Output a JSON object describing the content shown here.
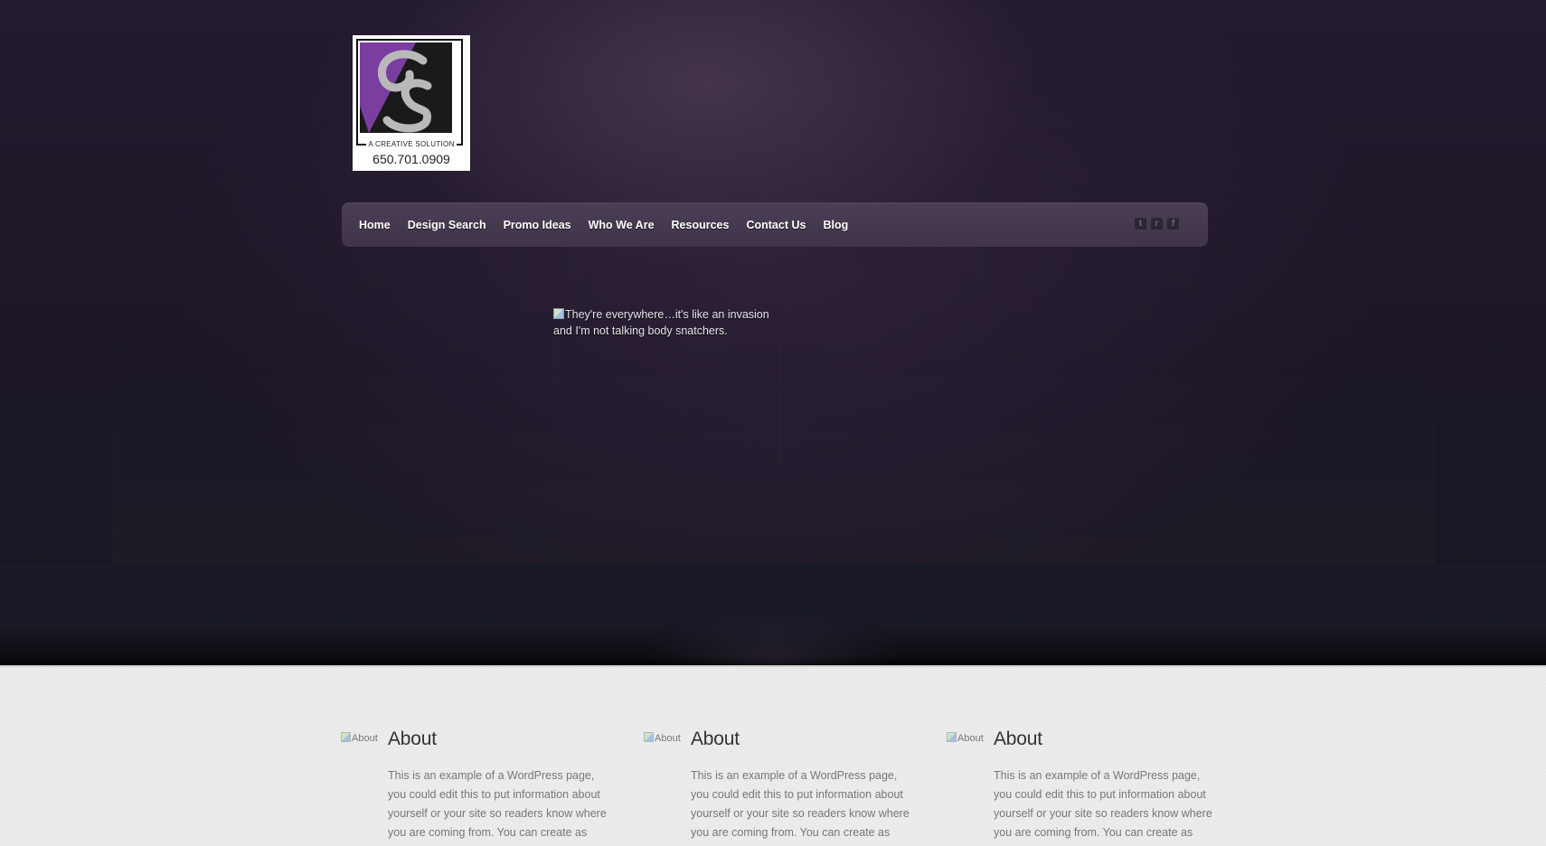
{
  "logo": {
    "monogram": "CS",
    "tagline": "A CREATIVE SOLUTION",
    "phone": "650.701.0909"
  },
  "nav": {
    "items": [
      {
        "label": "Home"
      },
      {
        "label": "Design Search"
      },
      {
        "label": "Promo Ideas"
      },
      {
        "label": "Who We Are"
      },
      {
        "label": "Resources"
      },
      {
        "label": "Contact Us"
      },
      {
        "label": "Blog"
      }
    ],
    "social": [
      {
        "icon": "twitter-icon",
        "glyph": "t"
      },
      {
        "icon": "rss-icon",
        "glyph": "r"
      },
      {
        "icon": "facebook-icon",
        "glyph": "f"
      }
    ]
  },
  "slider": {
    "caption": "They're everywhere…it's like an invasion and I'm not talking body snatchers."
  },
  "columns": [
    {
      "image_alt": "About",
      "title": "About",
      "text": "This is an example of a WordPress page, you could edit this to put information about yourself or your site so readers know where you are coming from. You can create as many pages like this one or sub-pages as"
    },
    {
      "image_alt": "About",
      "title": "About",
      "text": "This is an example of a WordPress page, you could edit this to put information about yourself or your site so readers know where you are coming from. You can create as many pages like this one or sub-pages as"
    },
    {
      "image_alt": "About",
      "title": "About",
      "text": "This is an example of a WordPress page, you could edit this to put information about yourself or your site so readers know where you are coming from. You can create as many pages like this one or sub-pages as"
    }
  ],
  "colors": {
    "logo_purple": "#7a3ea0",
    "nav_bg": "#463a51",
    "hero_bg": "#1f1828",
    "content_bg": "#ececec"
  }
}
